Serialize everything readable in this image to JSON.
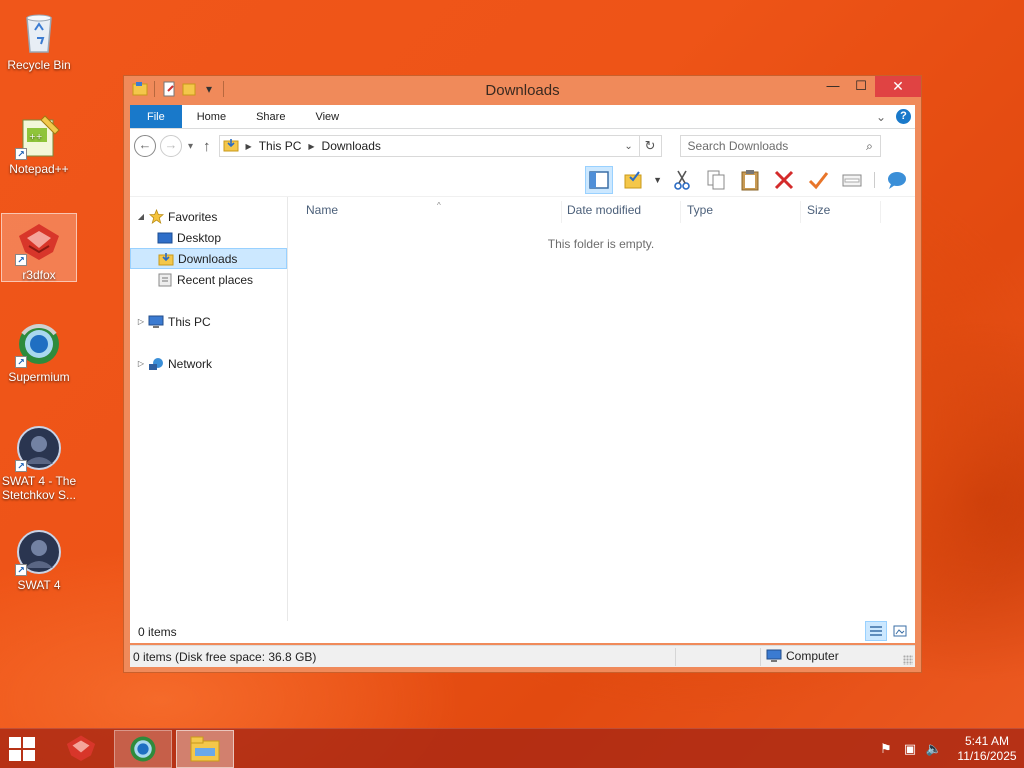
{
  "desktop": {
    "icons": [
      {
        "label": "Recycle Bin",
        "icon": "recycle-bin-icon"
      },
      {
        "label": "Notepad++",
        "icon": "notepad-plus-plus-icon"
      },
      {
        "label": "r3dfox",
        "icon": "r3dfox-icon"
      },
      {
        "label": "Supermium",
        "icon": "supermium-icon"
      },
      {
        "label": "SWAT 4 - The Stetchkov S...",
        "icon": "swat4-stetchkov-icon"
      },
      {
        "label": "SWAT 4",
        "icon": "swat4-icon"
      }
    ]
  },
  "window": {
    "title": "Downloads",
    "controls": {
      "minimize": "—",
      "maximize": "☐",
      "close": "✕"
    },
    "ribbon_tabs": [
      "File",
      "Home",
      "Share",
      "View"
    ],
    "address": {
      "segments": [
        "This PC",
        "Downloads"
      ]
    },
    "search": {
      "placeholder": "Search Downloads"
    },
    "nav": {
      "favorites": "Favorites",
      "desktop": "Desktop",
      "downloads": "Downloads",
      "recent": "Recent places",
      "this_pc": "This PC",
      "network": "Network"
    },
    "columns": [
      "Name",
      "Date modified",
      "Type",
      "Size"
    ],
    "empty_message": "This folder is empty.",
    "item_count": "0 items",
    "status_text": "0 items (Disk free space: 36.8 GB)",
    "status_location": "Computer"
  },
  "taskbar": {
    "time": "5:41 AM",
    "date": "11/16/2025"
  },
  "colors": {
    "accent": "#1979ca",
    "window_frame": "#f08a5a",
    "selection": "#cce8ff"
  }
}
